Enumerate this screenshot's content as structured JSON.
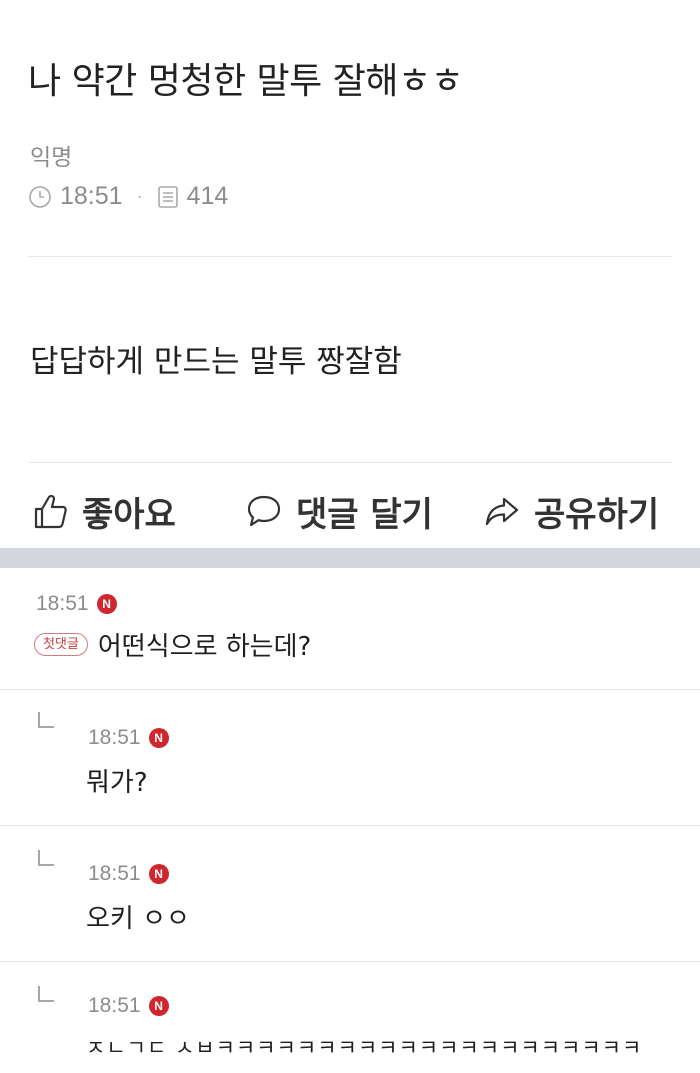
{
  "post": {
    "title": "나 약간 멍청한 말투 잘해ㅎㅎ",
    "author": "익명",
    "time": "18:51",
    "views": "414",
    "body": "답답하게 만드는 말투 짱잘함"
  },
  "actions": {
    "like_label": "좋아요",
    "comment_label": "댓글 달기",
    "share_label": "공유하기"
  },
  "comments": [
    {
      "time": "18:51",
      "badge": "N",
      "first_label": "첫댓글",
      "text": "어떤식으로 하는데?"
    },
    {
      "time": "18:51",
      "badge": "N",
      "text": "뭐가?"
    },
    {
      "time": "18:51",
      "badge": "N",
      "text": "오키 ㅇㅇ"
    },
    {
      "time": "18:51",
      "badge": "N",
      "text": "ㅈㄴㄱㄷ ㅅㅂㅋㅋㅋㅋㅋㅋㅋㅋㅋㅋㅋㅋㅋㅋㅋㅋㅋㅋㅋㅋㅋ"
    }
  ],
  "colors": {
    "badge_red": "#d0262e",
    "section_band": "#d2d5da",
    "meta_gray": "#8c8c8c"
  }
}
